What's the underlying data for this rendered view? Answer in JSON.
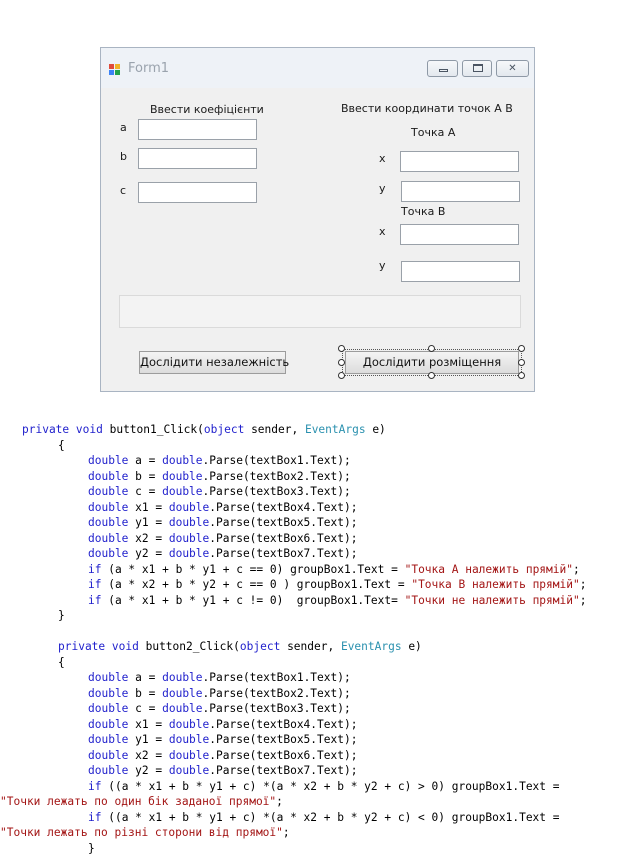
{
  "window": {
    "title": "Form1",
    "minimize_glyph": "",
    "maximize_glyph": "",
    "close_glyph": "✕"
  },
  "form": {
    "coef_header": "Ввести коефіцієнти",
    "coords_header": "Ввести координати точок А В",
    "label_a": "a",
    "label_b": "b",
    "label_c": "c",
    "point_a_header": "Точка А",
    "point_b_header": "Точка В",
    "label_xa": "x",
    "label_ya": "y",
    "label_xb": "x",
    "label_yb": "y",
    "textbox_values": [
      "",
      "",
      "",
      "",
      "",
      "",
      ""
    ],
    "groupbox_text": "",
    "button1_label": "Дослідити незалежність",
    "button2_label": "Дослідити розміщення"
  },
  "colors": {
    "keyword": "#1f1fcc",
    "type": "#2b91af",
    "string": "#a31515"
  },
  "code": {
    "method1_kw1": "private",
    "method1_kw2": "void",
    "method1_name": " button1_Click(",
    "kw_object": "object",
    "sender": " sender, ",
    "type_eventargs": "EventArgs",
    "param_e": " e)",
    "open_brace": "{",
    "close_brace": "}",
    "kw_double": "double",
    "kw_if": "if",
    "decl_a": " a = ",
    "decl_b": " b = ",
    "decl_c": " c = ",
    "decl_x1": " x1 = ",
    "decl_y1": " y1 = ",
    "decl_x2": " x2 = ",
    "decl_y2": " y2 = ",
    "parse1": ".Parse(textBox1.Text);",
    "parse2": ".Parse(textBox2.Text);",
    "parse3": ".Parse(textBox3.Text);",
    "parse4": ".Parse(textBox4.Text);",
    "parse5": ".Parse(textBox5.Text);",
    "parse6": ".Parse(textBox6.Text);",
    "parse7": ".Parse(textBox7.Text);",
    "cond1": " (a * x1 + b * y1 + c == 0) groupBox1.Text = ",
    "str1": "\"Точка А належить прямій\"",
    "cond2": " (a * x2 + b * y2 + c == 0 ) groupBox1.Text = ",
    "str2": "\"Точка В належить прямій\"",
    "cond3": " (a * x1 + b * y1 + c != 0)  groupBox1.Text= ",
    "str3": "\"Точки не належить прямій\"",
    "semicolon": ";",
    "method2_name": " button2_Click(",
    "cond4": " ((a * x1 + b * y1 + c) *(a * x2 + b * y2 + c) > 0) groupBox1.Text =",
    "str4": "\"Точки лежать по один бік заданої прямої\"",
    "cond5": " ((a * x1 + b * y1 + c) *(a * x2 + b * y2 + c) < 0) groupBox1.Text =",
    "str5": "\"Точки лежать по різні сторони від прямої\""
  }
}
